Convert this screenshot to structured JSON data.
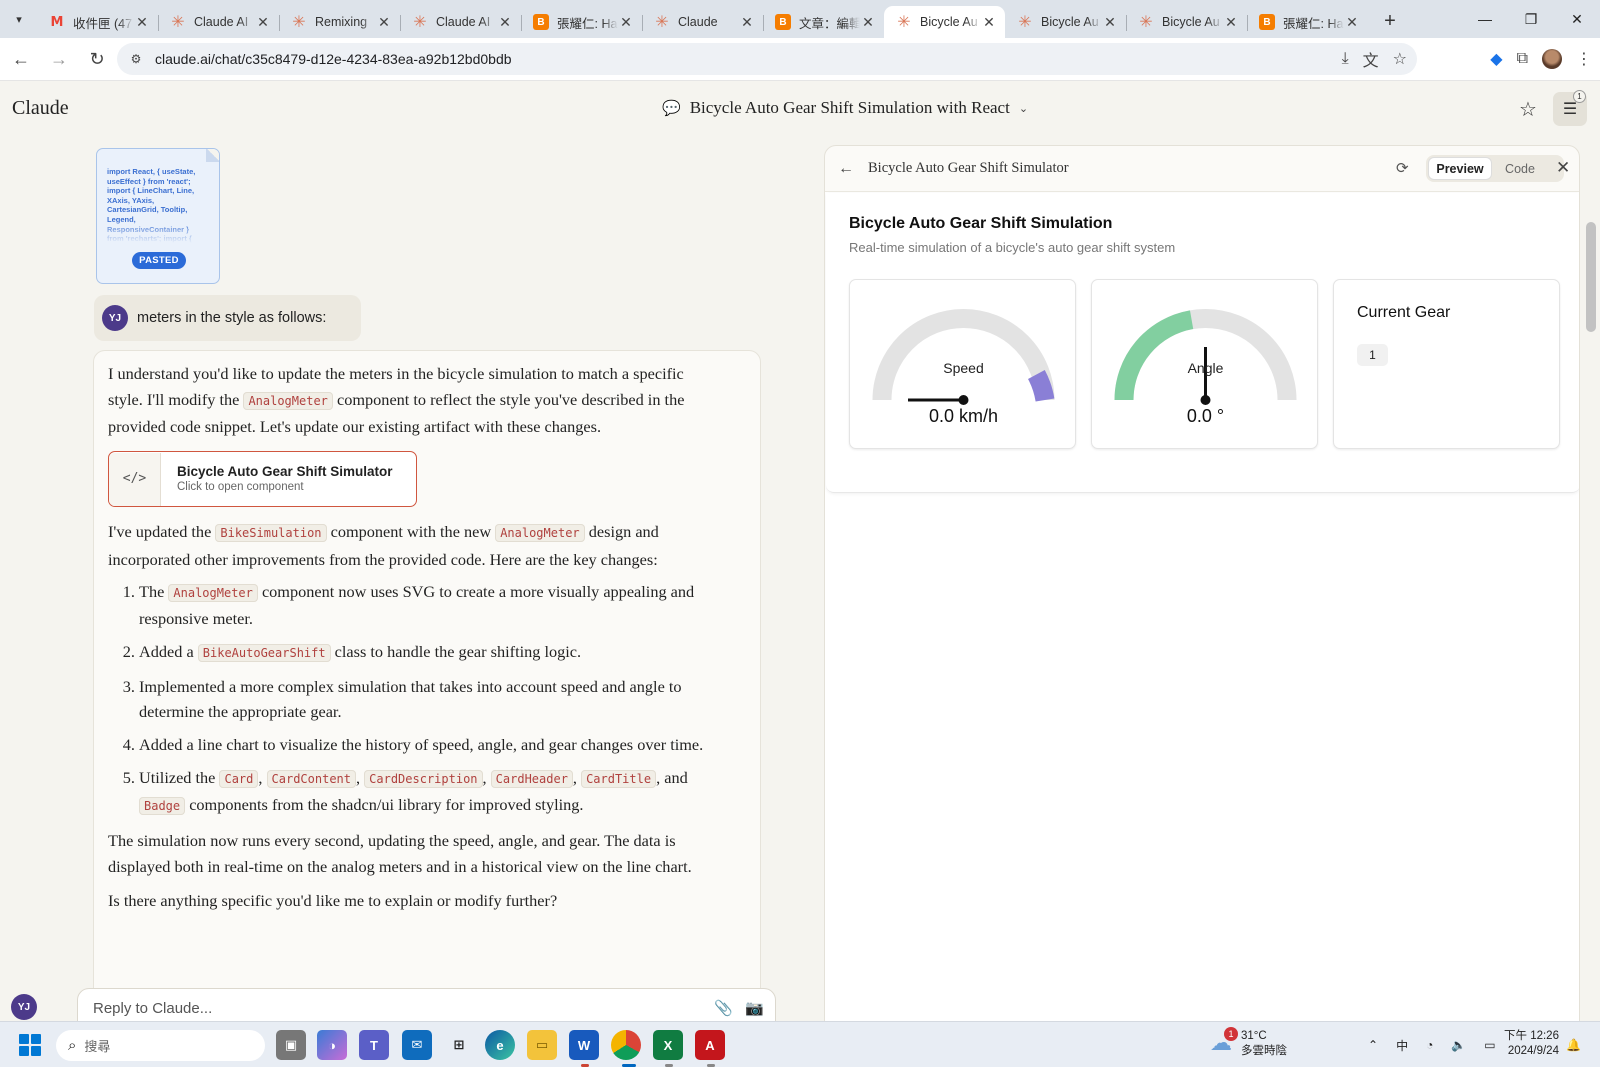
{
  "browser": {
    "tabs": [
      {
        "title": "收件匣 (47",
        "favicon": "gmail"
      },
      {
        "title": "Claude AI",
        "favicon": "claude"
      },
      {
        "title": "Remixing",
        "favicon": "claude"
      },
      {
        "title": "Claude AI",
        "favicon": "claude"
      },
      {
        "title": "張耀仁: Ha",
        "favicon": "blogger"
      },
      {
        "title": "Claude",
        "favicon": "claude"
      },
      {
        "title": "文章：編輯",
        "favicon": "blogger"
      },
      {
        "title": "Bicycle Au",
        "favicon": "claude",
        "active": true
      },
      {
        "title": "Bicycle Au",
        "favicon": "claude"
      },
      {
        "title": "Bicycle Au",
        "favicon": "claude"
      },
      {
        "title": "張耀仁: Ha",
        "favicon": "blogger"
      }
    ],
    "url": "claude.ai/chat/c35c8479-d12e-4234-83ea-a92b12bd0bdb"
  },
  "app": {
    "logo": "Claude",
    "chat_title": "Bicycle Auto Gear Shift Simulation with React",
    "settings_badge": "1"
  },
  "pasted": {
    "preview": "import React, { useState, useEffect } from 'react'; import { LineChart, Line, XAxis, YAxis, CartesianGrid, Tooltip, Legend, ResponsiveContainer } from 'recharts'; import {",
    "badge": "PASTED"
  },
  "user_message": {
    "avatar": "YJ",
    "text": "meters in the style as follows:"
  },
  "assistant": {
    "p1_a": "I understand you'd like to update the meters in the bicycle simulation to match a specific style. I'll modify the ",
    "p1_code": "AnalogMeter",
    "p1_b": " component to reflect the style you've described in the provided code snippet. Let's update our existing artifact with these changes.",
    "artifact_title": "Bicycle Auto Gear Shift Simulator",
    "artifact_sub": "Click to open component",
    "p2_a": "I've updated the ",
    "p2_code1": "BikeSimulation",
    "p2_b": " component with the new ",
    "p2_code2": "AnalogMeter",
    "p2_c": " design and incorporated other improvements from the provided code. Here are the key changes:",
    "li1_a": "The ",
    "li1_code": "AnalogMeter",
    "li1_b": " component now uses SVG to create a more visually appealing and responsive meter.",
    "li2_a": "Added a ",
    "li2_code": "BikeAutoGearShift",
    "li2_b": " class to handle the gear shifting logic.",
    "li3": "Implemented a more complex simulation that takes into account speed and angle to determine the appropriate gear.",
    "li4": "Added a line chart to visualize the history of speed, angle, and gear changes over time.",
    "li5_a": "Utilized the ",
    "li5_c1": "Card",
    "li5_c2": "CardContent",
    "li5_c3": "CardDescription",
    "li5_c4": "CardHeader",
    "li5_c5": "CardTitle",
    "li5_and": ", and",
    "li5_c6": "Badge",
    "li5_b": " components from the shadcn/ui library for improved styling.",
    "sep": ", ",
    "p3": "The simulation now runs every second, updating the speed, angle, and gear. The data is displayed both in real-time on the analog meters and in a historical view on the line chart.",
    "p4": "Is there anything specific you'd like me to explain or modify further?"
  },
  "composer": {
    "placeholder": "Reply to Claude..."
  },
  "panel": {
    "title": "Bicycle Auto Gear Shift Simulator",
    "tab_preview": "Preview",
    "tab_code": "Code",
    "sim_title": "Bicycle Auto Gear Shift Simulation",
    "sim_desc": "Real-time simulation of a bicycle's auto gear shift system",
    "speed_label": "Speed",
    "speed_value": "0.0 km/h",
    "angle_label": "Angle",
    "angle_value": "0.0 °",
    "gear_title": "Current Gear",
    "gear_value": "1",
    "colors": {
      "speed_accent": "#8a7fd6",
      "angle_accent": "#82cfa0",
      "track": "#e3e3e3"
    }
  },
  "taskbar": {
    "search_placeholder": "搜尋",
    "weather_temp": "31°C",
    "weather_desc": "多雲時陰",
    "weather_badge": "1",
    "ime": "中",
    "time": "下午 12:26",
    "date": "2024/9/24"
  }
}
